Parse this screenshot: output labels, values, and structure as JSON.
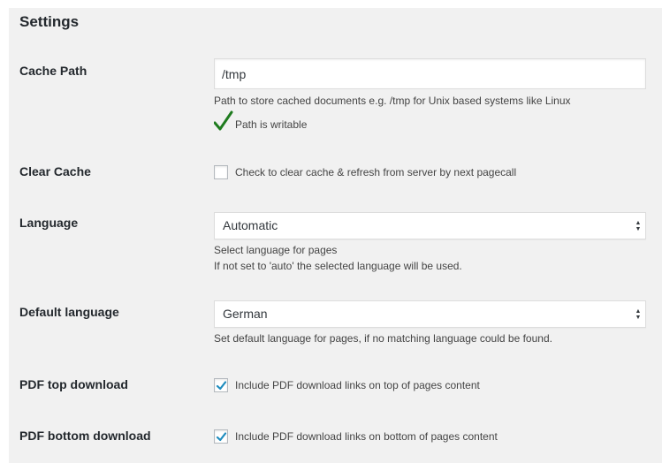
{
  "settings": {
    "title": "Settings",
    "cache_path": {
      "label": "Cache Path",
      "value": "/tmp",
      "description": "Path to store cached documents e.g. /tmp for Unix based systems like Linux",
      "status": "Path is writable",
      "status_color": "#1e7b1e"
    },
    "clear_cache": {
      "label": "Clear Cache",
      "checkbox_label": "Check to clear cache & refresh from server by next pagecall",
      "checked": false
    },
    "language": {
      "label": "Language",
      "selected": "Automatic",
      "description_1": "Select language for pages",
      "description_2": "If not set to 'auto' the selected language will be used."
    },
    "default_language": {
      "label": "Default language",
      "selected": "German",
      "description": "Set default language for pages, if no matching language could be found."
    },
    "pdf_top": {
      "label": "PDF top download",
      "checkbox_label": "Include PDF download links on top of pages content",
      "checked": true
    },
    "pdf_bottom": {
      "label": "PDF bottom download",
      "checkbox_label": "Include PDF download links on bottom of pages content",
      "checked": true
    },
    "accent_color": "#1e8cbe"
  }
}
